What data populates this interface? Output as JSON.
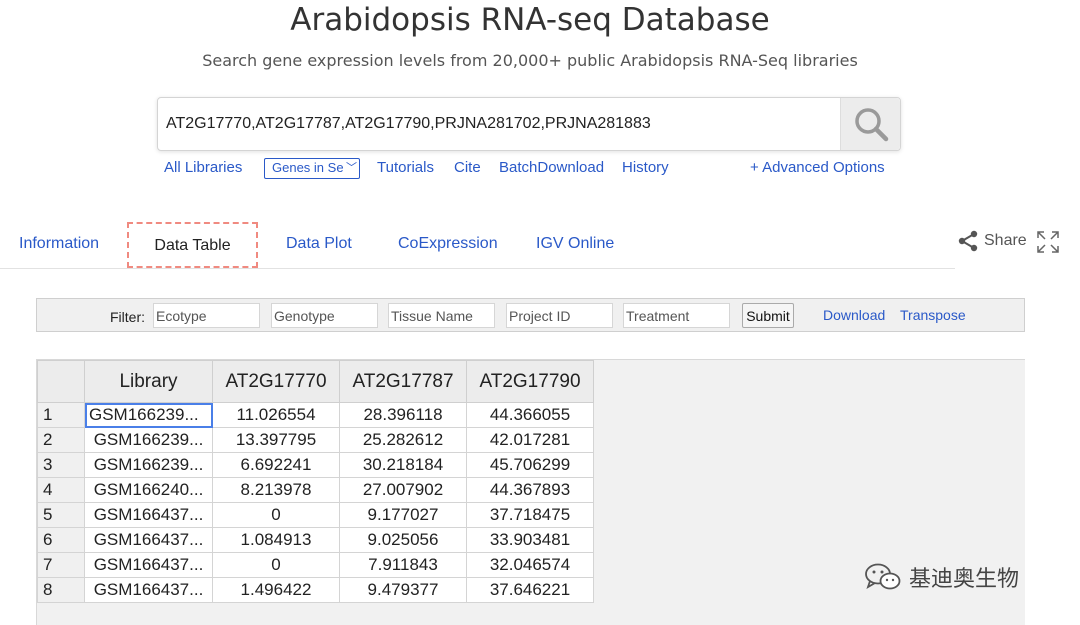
{
  "header": {
    "title": "Arabidopsis RNA-seq Database",
    "subtitle": "Search gene expression levels from 20,000+ public Arabidopsis RNA-Seq libraries"
  },
  "search": {
    "value": "AT2G17770,AT2G17787,AT2G17790,PRJNA281702,PRJNA281883",
    "icon": "search-icon"
  },
  "links": {
    "all_libraries": "All Libraries",
    "genes_select": "Genes in Se",
    "tutorials": "Tutorials",
    "cite": "Cite",
    "batch_download": "BatchDownload",
    "history": "History",
    "advanced_options": "+ Advanced Options"
  },
  "tabs": [
    {
      "label": "Information"
    },
    {
      "label": "Data Table",
      "active": true
    },
    {
      "label": "Data Plot"
    },
    {
      "label": "CoExpression"
    },
    {
      "label": "IGV Online"
    }
  ],
  "share": {
    "label": "Share",
    "icon": "share-icon"
  },
  "filter": {
    "label": "Filter:",
    "placeholders": [
      "Ecotype",
      "Genotype",
      "Tissue Name",
      "Project ID",
      "Treatment"
    ],
    "submit": "Submit",
    "download": "Download",
    "transpose": "Transpose"
  },
  "table": {
    "headers": [
      "Library",
      "AT2G17770",
      "AT2G17787",
      "AT2G17790"
    ],
    "rows": [
      {
        "num": "1",
        "library": "GSM166239...",
        "v1": "11.026554",
        "v2": "28.396118",
        "v3": "44.366055"
      },
      {
        "num": "2",
        "library": "GSM166239...",
        "v1": "13.397795",
        "v2": "25.282612",
        "v3": "42.017281"
      },
      {
        "num": "3",
        "library": "GSM166239...",
        "v1": "6.692241",
        "v2": "30.218184",
        "v3": "45.706299"
      },
      {
        "num": "4",
        "library": "GSM166240...",
        "v1": "8.213978",
        "v2": "27.007902",
        "v3": "44.367893"
      },
      {
        "num": "5",
        "library": "GSM166437...",
        "v1": "0",
        "v2": "9.177027",
        "v3": "37.718475"
      },
      {
        "num": "6",
        "library": "GSM166437...",
        "v1": "1.084913",
        "v2": "9.025056",
        "v3": "33.903481"
      },
      {
        "num": "7",
        "library": "GSM166437...",
        "v1": "0",
        "v2": "7.911843",
        "v3": "32.046574"
      },
      {
        "num": "8",
        "library": "GSM166437...",
        "v1": "1.496422",
        "v2": "9.479377",
        "v3": "37.646221"
      }
    ]
  },
  "watermark": {
    "text": "基迪奥生物",
    "icon": "wechat-icon"
  },
  "colors": {
    "link": "#2a59c8",
    "active_tab_border": "#f08a80",
    "selection": "#4a7fe8"
  }
}
